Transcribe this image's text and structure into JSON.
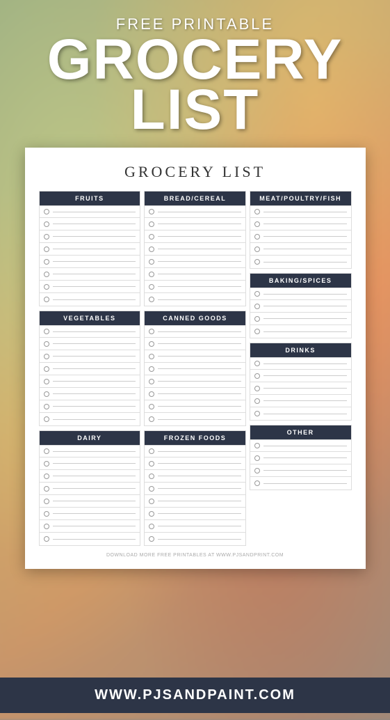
{
  "header": {
    "subtitle": "FREE PRINTABLE",
    "title_line1": "GROCERY",
    "title_line2": "LIST"
  },
  "card": {
    "title": "GROCERY LIST",
    "columns": {
      "col1": {
        "sections": [
          {
            "header": "FRUITS",
            "rows": 8
          },
          {
            "header": "VEGETABLES",
            "rows": 8
          },
          {
            "header": "DAIRY",
            "rows": 8
          }
        ]
      },
      "col2": {
        "sections": [
          {
            "header": "BREAD/CEREAL",
            "rows": 8
          },
          {
            "header": "CANNED GOODS",
            "rows": 8
          },
          {
            "header": "FROZEN FOODS",
            "rows": 8
          }
        ]
      },
      "col3": {
        "sections": [
          {
            "header": "MEAT/POULTRY/FISH",
            "rows": 5
          },
          {
            "header": "BAKING/SPICES",
            "rows": 4
          },
          {
            "header": "DRINKS",
            "rows": 5
          },
          {
            "header": "OTHER",
            "rows": 4
          }
        ]
      }
    },
    "footer": "DOWNLOAD MORE FREE PRINTABLES AT WWW.PJSANDPRINT.COM"
  },
  "bottom_bar": {
    "url": "WWW.PJSANDPAINT.COM"
  }
}
